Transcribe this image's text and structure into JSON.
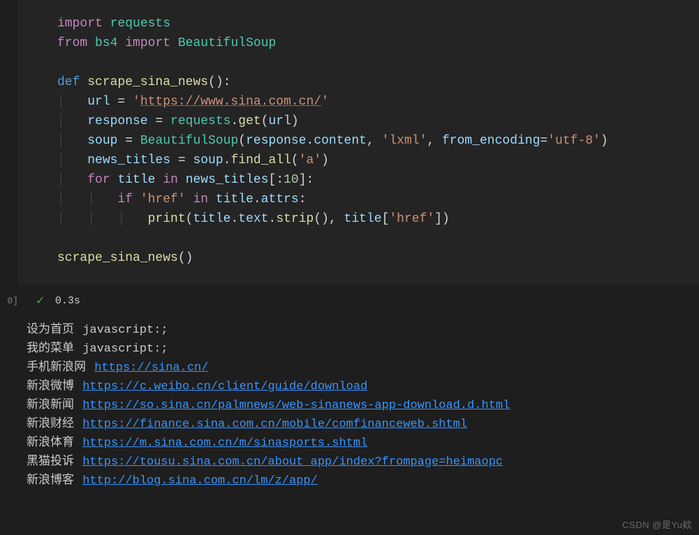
{
  "code": {
    "l1": {
      "kw1": "import",
      "mod": "requests"
    },
    "l2": {
      "kw1": "from",
      "mod1": "bs4",
      "kw2": "import",
      "mod2": "BeautifulSoup"
    },
    "l3": "",
    "l4": {
      "kw": "def",
      "fn": "scrape_sina_news",
      "paren": "():"
    },
    "l5": {
      "var": "url",
      "eq": " = ",
      "q1": "'",
      "url": "https://www.sina.com.cn/",
      "q2": "'"
    },
    "l6": {
      "var": "response",
      "eq": " = ",
      "mod": "requests",
      "dot": ".",
      "fn": "get",
      "open": "(",
      "arg": "url",
      "close": ")"
    },
    "l7": {
      "var": "soup",
      "eq": " = ",
      "cls": "BeautifulSoup",
      "open": "(",
      "a1": "response",
      "d1": ".",
      "a1b": "content",
      "c1": ", ",
      "s1": "'lxml'",
      "c2": ", ",
      "kw": "from_encoding",
      "eq2": "=",
      "s2": "'utf-8'",
      "close": ")"
    },
    "l8": {
      "var": "news_titles",
      "eq": " = ",
      "obj": "soup",
      "d": ".",
      "fn": "find_all",
      "open": "(",
      "s": "'a'",
      "close": ")"
    },
    "l9": {
      "kw": "for",
      "v1": "title",
      "kw2": "in",
      "v2": "news_titles",
      "slice": "[:",
      "num": "10",
      "slice2": "]:"
    },
    "l10": {
      "kw": "if",
      "s": "'href'",
      "kw2": "in",
      "v": "title",
      "d": ".",
      "attr": "attrs",
      "colon": ":"
    },
    "l11": {
      "fn": "print",
      "open": "(",
      "v1": "title",
      "d1": ".",
      "a1": "text",
      "d2": ".",
      "fn2": "strip",
      "p2": "()",
      "c": ", ",
      "v2": "title",
      "br": "[",
      "s": "'href'",
      "br2": "]",
      "close": ")"
    },
    "l12": "",
    "l13": {
      "fn": "scrape_sina_news",
      "paren": "()"
    }
  },
  "status": {
    "gutter": "0]",
    "time": "0.3s",
    "check_icon": "✓"
  },
  "output": [
    {
      "text": "设为首页",
      "link": "javascript:;",
      "is_url": false
    },
    {
      "text": "我的菜单",
      "link": "javascript:;",
      "is_url": false
    },
    {
      "text": "手机新浪网",
      "link": "https://sina.cn/",
      "is_url": true
    },
    {
      "text": "新浪微博",
      "link": "https://c.weibo.cn/client/guide/download",
      "is_url": true
    },
    {
      "text": "新浪新闻",
      "link": "https://so.sina.cn/palmnews/web-sinanews-app-download.d.html",
      "is_url": true
    },
    {
      "text": "新浪财经",
      "link": "https://finance.sina.com.cn/mobile/comfinanceweb.shtml",
      "is_url": true
    },
    {
      "text": "新浪体育",
      "link": "https://m.sina.com.cn/m/sinasports.shtml",
      "is_url": true
    },
    {
      "text": "黑猫投诉",
      "link": "https://tousu.sina.com.cn/about_app/index?frompage=heimaopc",
      "is_url": true
    },
    {
      "text": "新浪博客",
      "link": "http://blog.sina.com.cn/lm/z/app/",
      "is_url": true
    }
  ],
  "watermark": "CSDN @是Yu欸"
}
